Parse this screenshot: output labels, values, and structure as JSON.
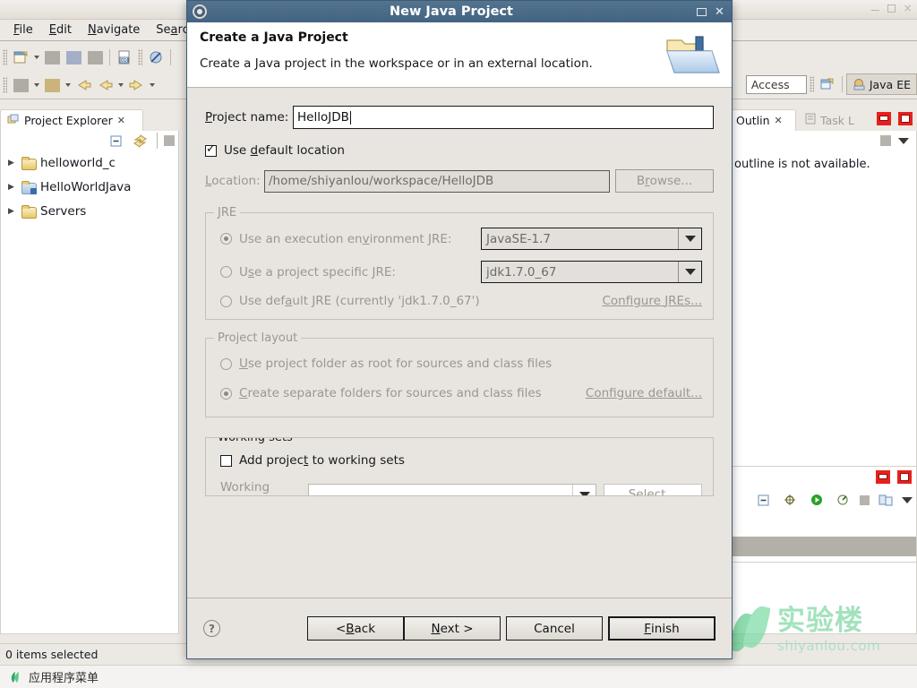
{
  "desktop": {
    "taskbar": {
      "app_menu_label": "应用程序菜单",
      "leaf_icon": "shiyanlou-leaf-icon"
    }
  },
  "watermark": {
    "cn": "实验楼",
    "en": "shiyanlou.com"
  },
  "eclipse": {
    "window_buttons": {
      "minimize": "–",
      "maximize": "□",
      "close": "×"
    },
    "menus": [
      {
        "label": "File",
        "mnemonic": "F"
      },
      {
        "label": "Edit",
        "mnemonic": "E"
      },
      {
        "label": "Navigate",
        "mnemonic": "N"
      },
      {
        "label": "Search",
        "mnemonic": "a"
      }
    ],
    "quick_access": {
      "value": "Access",
      "placeholder": "Quick Access"
    },
    "perspective": {
      "label": "Java EE"
    },
    "project_explorer": {
      "tab_label": "Project Explorer",
      "toolbar": [
        "collapse-all-icon",
        "link-with-editor-icon"
      ],
      "items": [
        {
          "label": "helloworld_c",
          "type": "c-project"
        },
        {
          "label": "HelloWorldJava",
          "type": "java-project"
        },
        {
          "label": "Servers",
          "type": "folder"
        }
      ]
    },
    "outline": {
      "tabs": [
        {
          "label": "Outlin",
          "active": true
        },
        {
          "label": "Task L",
          "active": false
        }
      ],
      "message": "outline is not available."
    },
    "status_bar": {
      "text": "0 items selected"
    }
  },
  "dialog": {
    "title": "New Java Project",
    "title_icon": "gear-icon",
    "title_buttons": {
      "maximize": "□",
      "close": "✕"
    },
    "header": {
      "heading": "Create a Java Project",
      "subheading": "Create a Java project in the workspace or in an external location.",
      "icon": "new-java-project-folder-icon"
    },
    "project_name": {
      "label": "Project name:",
      "mnemonic": "P",
      "value": "HelloJDB",
      "placeholder": ""
    },
    "use_default_location": {
      "label": "Use default location",
      "mnemonic": "d",
      "checked": true
    },
    "location": {
      "label": "Location:",
      "mnemonic": "L",
      "value": "/home/shiyanlou/workspace/HelloJDB",
      "browse_label": "Browse...",
      "browse_mnemonic": "r",
      "disabled": true
    },
    "jre_group": {
      "title": "JRE",
      "execution_env": {
        "label": "Use an execution environment JRE:",
        "mnemonic": "v",
        "selected": true,
        "value": "JavaSE-1.7"
      },
      "project_specific": {
        "label": "Use a project specific JRE:",
        "mnemonic": "s",
        "selected": false,
        "value": "jdk1.7.0_67"
      },
      "default_jre": {
        "label": "Use default JRE (currently 'jdk1.7.0_67')",
        "mnemonic": "a",
        "selected": false
      },
      "configure_link": {
        "label": "Configure JREs...",
        "mnemonic": "J"
      }
    },
    "project_layout_group": {
      "title": "Project layout",
      "project_folder_root": {
        "label": "Use project folder as root for sources and class files",
        "mnemonic": "U",
        "selected": false
      },
      "separate_folders": {
        "label": "Create separate folders for sources and class files",
        "mnemonic": "C",
        "selected": true
      },
      "configure_link": {
        "label": "Configure default..."
      }
    },
    "working_sets_group": {
      "title": "Working sets",
      "add_to_working_sets": {
        "label": "Add project to working sets",
        "mnemonic": "t",
        "checked": false
      },
      "working_sets_row": {
        "label": "Working sets:",
        "value": "",
        "select_label": "Select..."
      }
    },
    "footer": {
      "help_icon": "help-question-icon",
      "buttons": [
        {
          "name": "back",
          "label": "< Back",
          "mnemonic": "B",
          "disabled": false,
          "default": false
        },
        {
          "name": "next",
          "label": "Next >",
          "mnemonic": "N",
          "disabled": false,
          "default": false
        },
        {
          "name": "cancel",
          "label": "Cancel",
          "mnemonic": "",
          "disabled": false,
          "default": false
        },
        {
          "name": "finish",
          "label": "Finish",
          "mnemonic": "F",
          "disabled": false,
          "default": true
        }
      ]
    }
  },
  "colors": {
    "dialog_titlebar": "#4a6a86",
    "dialog_body": "#e8e5e0",
    "eclipse_chrome": "#ece9e4",
    "panel_close_red": "#e8201b",
    "watermark_green": "#7fd8a4"
  }
}
